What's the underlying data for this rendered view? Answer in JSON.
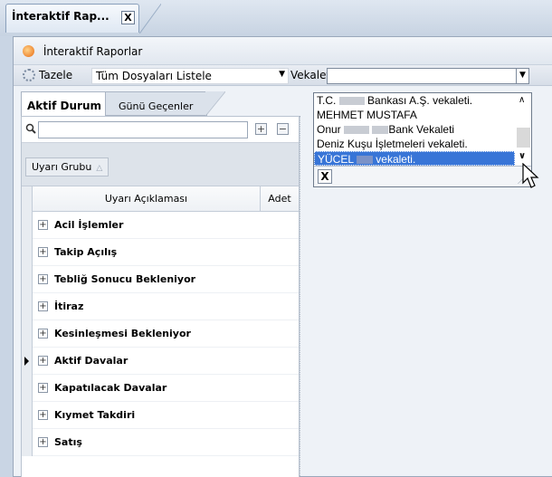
{
  "doc_tab": {
    "title": "İnteraktif Rap...",
    "close": "X"
  },
  "window": {
    "title": "İnteraktif Raporlar"
  },
  "toolbar": {
    "refresh_label": "Tazele",
    "files_select": "Tüm Dosyaları Listele",
    "vekalet_label": "Vekalet",
    "vekalet_value": ""
  },
  "tabs": [
    {
      "label": "Aktif Durum"
    },
    {
      "label": "Günü Geçenler"
    }
  ],
  "group": {
    "chip_label": "Uyarı Grubu"
  },
  "grid": {
    "col_desc": "Uyarı Açıklaması",
    "col_count": "Adet",
    "rows": [
      {
        "label": "Acil İşlemler"
      },
      {
        "label": "Takip Açılış"
      },
      {
        "label": "Tebliğ Sonucu Bekleniyor"
      },
      {
        "label": "İtiraz"
      },
      {
        "label": "Kesinleşmesi Bekleniyor"
      },
      {
        "label": "Aktif Davalar"
      },
      {
        "label": "Kapatılacak Davalar"
      },
      {
        "label": "Kıymet Takdiri"
      },
      {
        "label": "Satış"
      }
    ]
  },
  "popup": {
    "items": [
      {
        "pre": "T.C.",
        "post": "Bankası A.Ş. vekaleti."
      },
      {
        "pre": "MEHMET MUSTAFA",
        "post": ""
      },
      {
        "pre": "Onur",
        "post": "Bank Vekaleti"
      },
      {
        "pre": "Deniz Kuşu İşletmeleri vekaleti.",
        "post": ""
      },
      {
        "pre": "YÜCEL",
        "post": "vekaleti."
      }
    ],
    "clear": "X"
  }
}
